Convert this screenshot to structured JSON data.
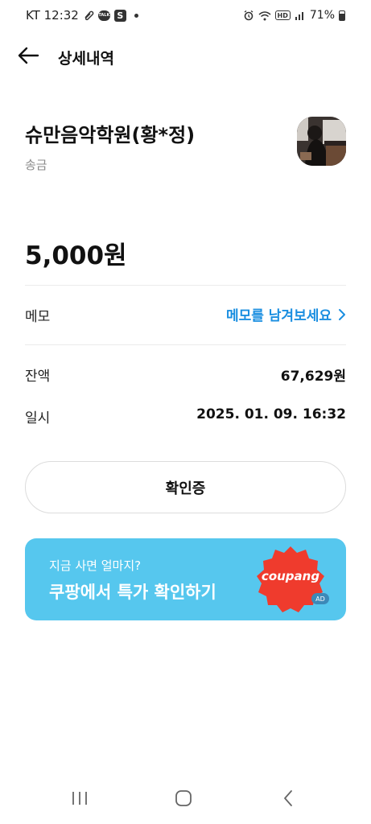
{
  "status_bar": {
    "carrier_time": "KT 12:32",
    "talk_icon_label": "TALK",
    "s_icon_label": "S",
    "hd_label": "HD",
    "battery_text": "71%"
  },
  "header": {
    "title": "상세내역"
  },
  "transaction": {
    "merchant_name": "슈만음악학원(황*정)",
    "type": "송금",
    "amount": "5,000원"
  },
  "memo": {
    "label": "메모",
    "link_text": "메모를 남겨보세요"
  },
  "details": {
    "balance_label": "잔액",
    "balance_value": "67,629원",
    "datetime_label": "일시",
    "datetime_value": "2025. 01. 09. 16:32"
  },
  "confirm_button": {
    "label": "확인증"
  },
  "ad": {
    "subtitle": "지금 사면 얼마지?",
    "title": "쿠팡에서 특가 확인하기",
    "brand": "coupang",
    "tag": "AD"
  },
  "colors": {
    "accent_blue": "#1a8ee0",
    "ad_background": "#56c7ee",
    "ad_badge_red": "#ef3b2d"
  },
  "icons": {
    "back": "arrow-left-icon",
    "memo_chevron": "chevron-right-icon",
    "nav_recent": "recent-apps-icon",
    "nav_home": "home-icon",
    "nav_back": "back-chevron-icon"
  }
}
